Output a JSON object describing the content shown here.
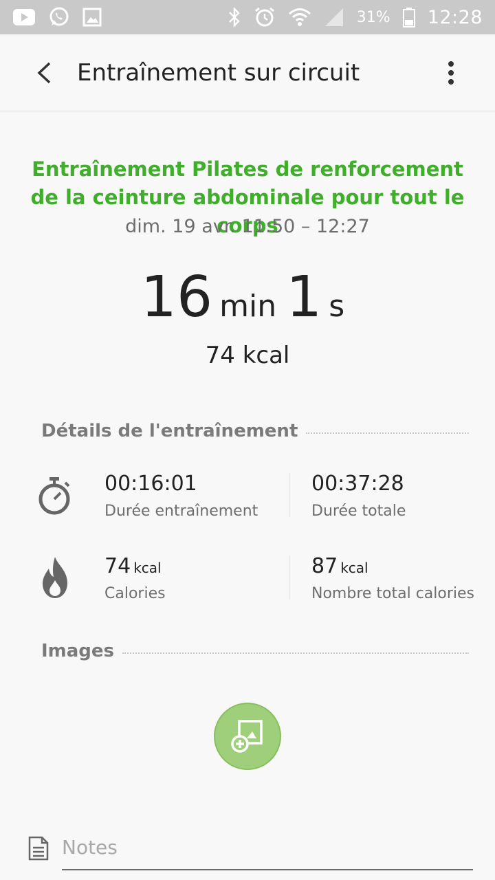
{
  "status_bar": {
    "battery_percent": "31%",
    "clock": "12:28",
    "left_icons": [
      "youtube-icon",
      "whatsapp-icon",
      "gallery-icon"
    ],
    "right_icons": [
      "bluetooth-icon",
      "alarm-icon",
      "wifi-icon",
      "signal-icon",
      "battery-icon"
    ]
  },
  "app_bar": {
    "title": "Entraînement sur circuit",
    "back_icon": "back-arrow-icon",
    "menu_icon": "more-vert-icon"
  },
  "workout": {
    "title": "Entraînement Pilates de renforcement de la ceinture abdominale pour tout le corps",
    "time_range": "dim. 19 avr. 11:50 – 12:27",
    "duration": {
      "minutes": "16",
      "min_unit": "min",
      "seconds": "1",
      "sec_unit": "s"
    },
    "calories": "74 kcal"
  },
  "details": {
    "section_label": "Détails de l'entraînement",
    "workout_duration": {
      "value": "00:16:01",
      "label": "Durée entraînement"
    },
    "total_duration": {
      "value": "00:37:28",
      "label": "Durée totale"
    },
    "calories": {
      "value": "74",
      "unit": "kcal",
      "label": "Calories"
    },
    "total_calories": {
      "value": "87",
      "unit": "kcal",
      "label": "Nombre total calories"
    },
    "icons": [
      "stopwatch-icon",
      "flame-icon"
    ]
  },
  "images": {
    "section_label": "Images",
    "add_button_icon": "add-image-icon"
  },
  "notes": {
    "placeholder": "Notes",
    "value": "",
    "icon": "note-icon"
  },
  "colors": {
    "accent_green": "#3fae2a",
    "add_button": "#9fcf7b",
    "status_bar": "#c9c9c9"
  }
}
